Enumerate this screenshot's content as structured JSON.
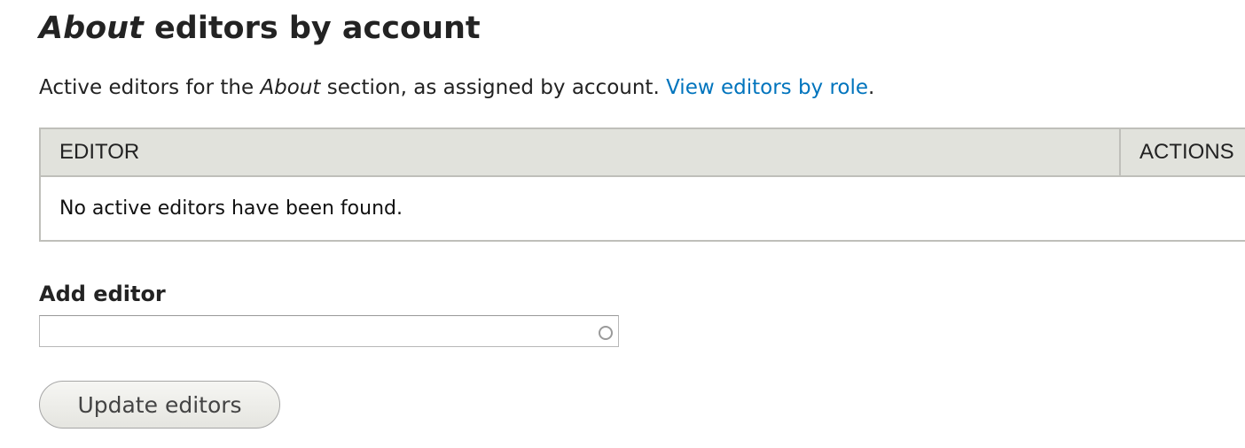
{
  "heading": {
    "title_italic": "About",
    "title_rest": " editors by account"
  },
  "intro": {
    "prefix": "Active editors for the ",
    "section_name": "About",
    "suffix": " section, as assigned by account. ",
    "link_text": "View editors by role",
    "end": "."
  },
  "table": {
    "columns": [
      "EDITOR",
      "ACTIONS"
    ],
    "empty_message": "No active editors have been found."
  },
  "add_editor": {
    "label": "Add editor",
    "value": "",
    "placeholder": ""
  },
  "actions": {
    "update_label": "Update editors"
  },
  "colors": {
    "link": "#0074bd",
    "table_header_bg": "#e1e2dc",
    "border": "#bfbfba"
  }
}
